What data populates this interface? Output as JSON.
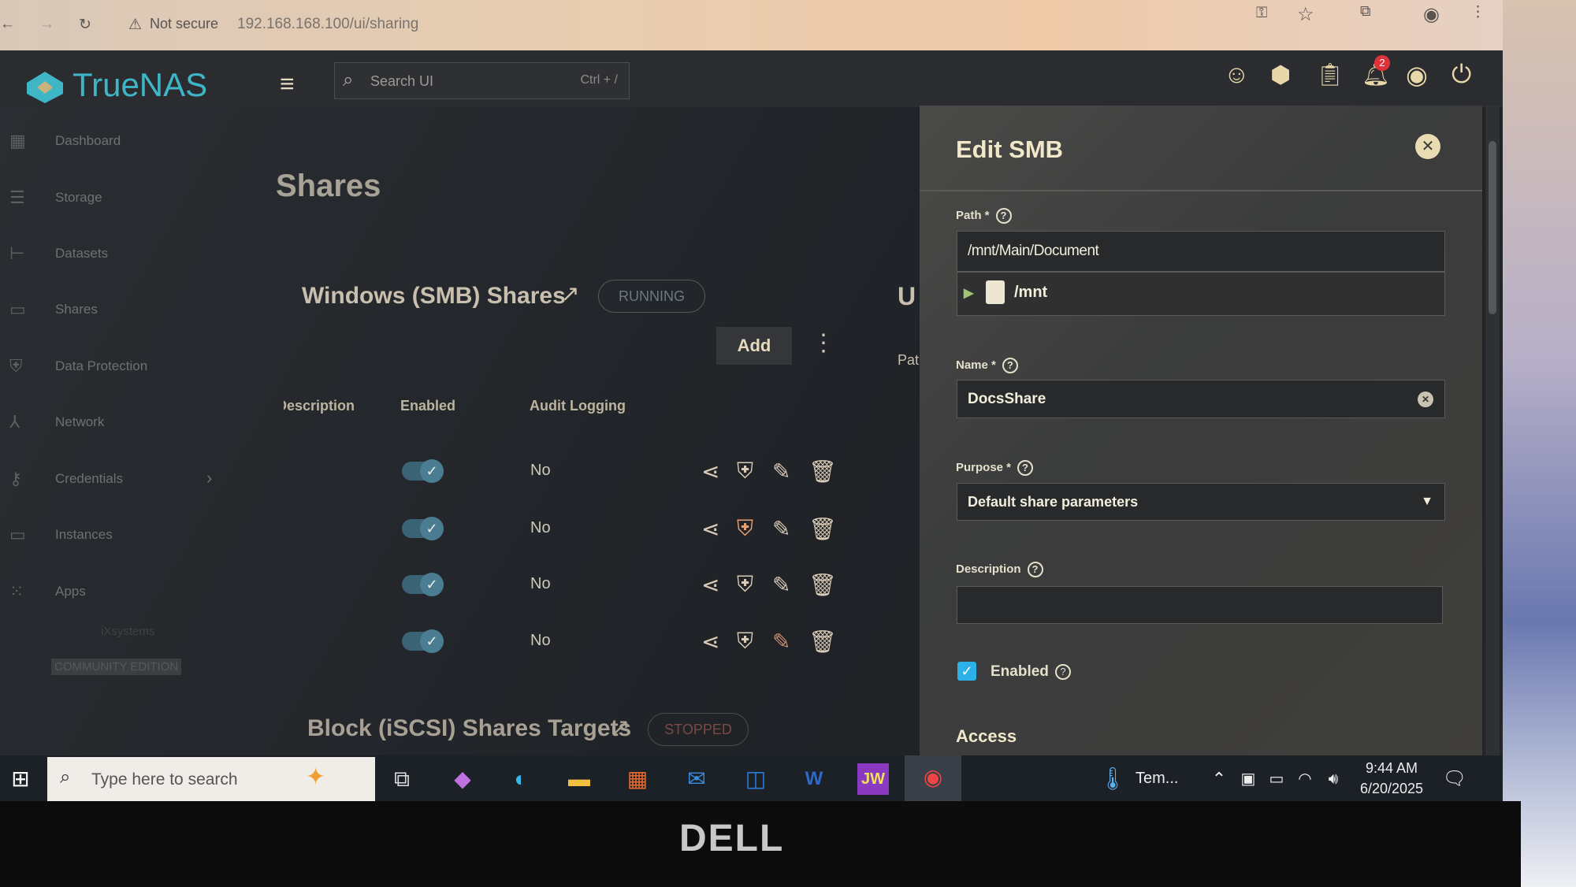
{
  "browser": {
    "not_secure": "Not secure",
    "url": "192.168.168.100/ui/sharing"
  },
  "header": {
    "logo": "TrueNAS",
    "search_placeholder": "Search UI",
    "search_shortcut": "Ctrl + /",
    "notification_count": "2"
  },
  "sidebar": {
    "items": [
      {
        "label": "Dashboard",
        "icon": "dashboard-icon"
      },
      {
        "label": "Storage",
        "icon": "storage-icon"
      },
      {
        "label": "Datasets",
        "icon": "datasets-icon"
      },
      {
        "label": "Shares",
        "icon": "shares-icon"
      },
      {
        "label": "Data Protection",
        "icon": "shield-icon"
      },
      {
        "label": "Network",
        "icon": "network-icon"
      },
      {
        "label": "Credentials",
        "icon": "key-icon"
      },
      {
        "label": "Instances",
        "icon": "laptop-icon"
      },
      {
        "label": "Apps",
        "icon": "apps-icon"
      }
    ],
    "brand": "iXsystems",
    "edition": "COMMUNITY EDITION"
  },
  "page": {
    "title": "Shares"
  },
  "smb": {
    "title": "Windows (SMB) Shares",
    "status": "RUNNING",
    "add_label": "Add",
    "columns": [
      "Description",
      "Enabled",
      "Audit Logging"
    ],
    "rows": [
      {
        "enabled": true,
        "audit": "No"
      },
      {
        "enabled": true,
        "audit": "No"
      },
      {
        "enabled": true,
        "audit": "No"
      },
      {
        "enabled": true,
        "audit": "No"
      }
    ]
  },
  "behind": {
    "unix_title": "U",
    "path_col": "Pat"
  },
  "iscsi": {
    "title": "Block (iSCSI) Shares Targets",
    "status": "STOPPED"
  },
  "panel": {
    "title": "Edit SMB",
    "path_label": "Path *",
    "path_value": "/mnt/Main/Document",
    "tree_root": "/mnt",
    "name_label": "Name *",
    "name_value": "DocsShare",
    "purpose_label": "Purpose *",
    "purpose_value": "Default share parameters",
    "description_label": "Description",
    "description_value": "",
    "enabled_label": "Enabled",
    "enabled": true,
    "access_heading": "Access"
  },
  "taskbar": {
    "search_placeholder": "Type here to search",
    "weather": "Tem...",
    "time": "9:44 AM",
    "date": "6/20/2025"
  },
  "bezel": {
    "brand": "DELL"
  },
  "colors": {
    "accent": "#0095d5",
    "toggle": "#3a6476",
    "panel": "#3d3d3b"
  }
}
